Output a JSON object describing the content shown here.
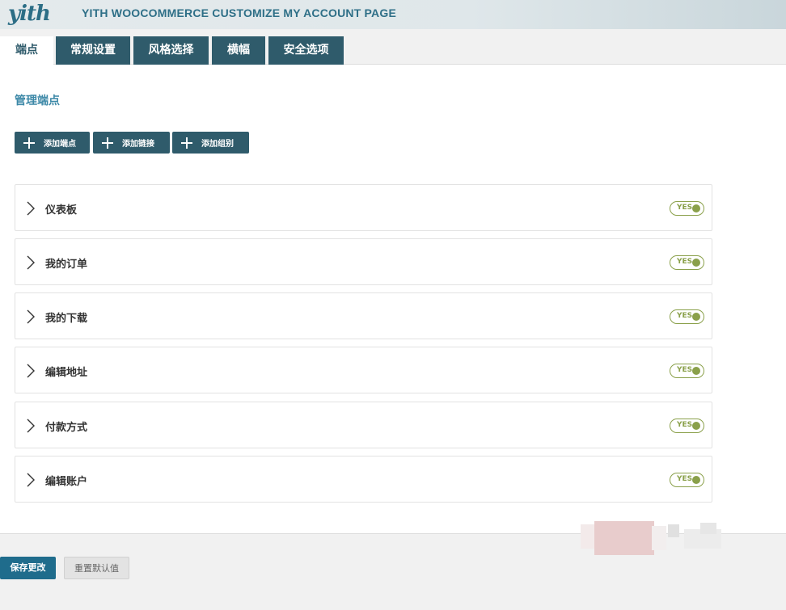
{
  "header": {
    "logo": "yith",
    "title": "YITH WOOCOMMERCE CUSTOMIZE MY ACCOUNT PAGE"
  },
  "tabs": [
    {
      "label": "端点",
      "active": true
    },
    {
      "label": "常规设置",
      "active": false
    },
    {
      "label": "风格选择",
      "active": false
    },
    {
      "label": "横幅",
      "active": false
    },
    {
      "label": "安全选项",
      "active": false
    }
  ],
  "main": {
    "section_title": "管理端点",
    "add_buttons": [
      {
        "label": "添加端点",
        "icon": "plus-icon"
      },
      {
        "label": "添加链接",
        "icon": "plus-icon"
      },
      {
        "label": "添加组别",
        "icon": "plus-icon"
      }
    ],
    "endpoints": [
      {
        "label": "仪表板",
        "toggle": "YES"
      },
      {
        "label": "我的订单",
        "toggle": "YES"
      },
      {
        "label": "我的下载",
        "toggle": "YES"
      },
      {
        "label": "编辑地址",
        "toggle": "YES"
      },
      {
        "label": "付款方式",
        "toggle": "YES"
      },
      {
        "label": "编辑账户",
        "toggle": "YES"
      }
    ]
  },
  "footer": {
    "save_label": "保存更改",
    "reset_label": "重置默认值"
  },
  "colors": {
    "brand": "#2f5b6b",
    "title_accent": "#3c88a7",
    "toggle_on": "#8aa04a",
    "save_button": "#1f6c8c"
  }
}
